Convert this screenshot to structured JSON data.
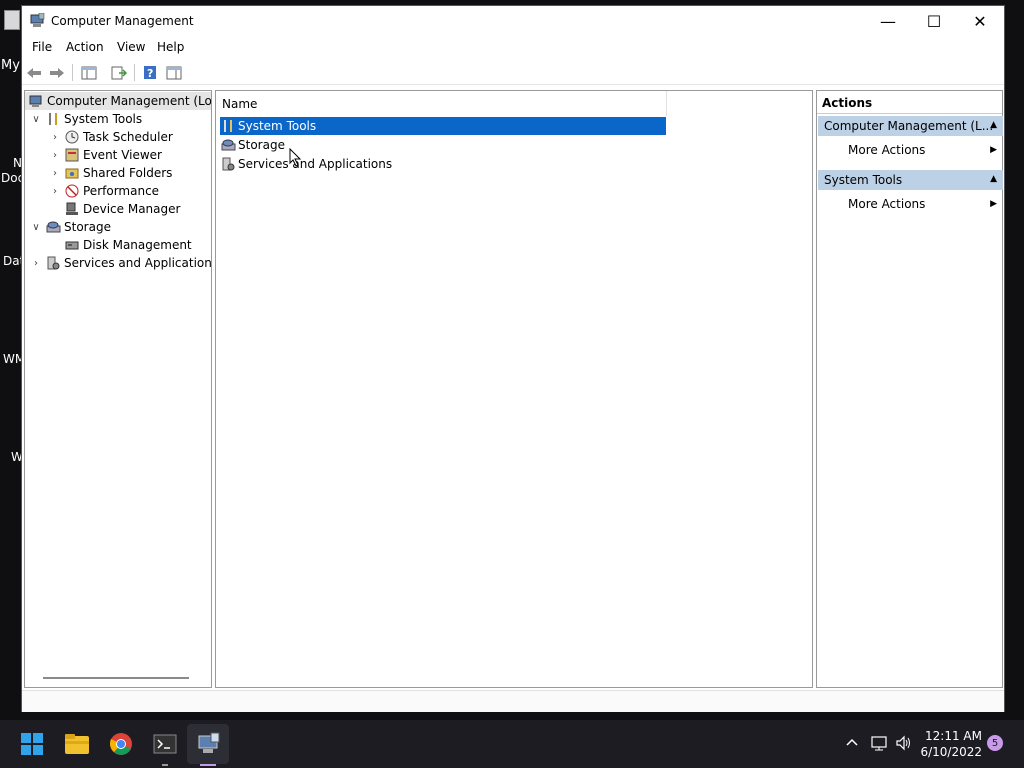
{
  "window": {
    "title": "Computer Management",
    "minimize_glyph": "—",
    "maximize_glyph": "☐",
    "close_glyph": "✕"
  },
  "desktop_icons": [
    "My",
    "N",
    "Doc",
    "Dat",
    "WM",
    "W"
  ],
  "menu": [
    "File",
    "Action",
    "View",
    "Help"
  ],
  "toolbar": {
    "back_icon": "back-arrow-icon",
    "forward_icon": "forward-arrow-icon",
    "show_hide_tree_icon": "console-tree-icon",
    "export_icon": "export-list-icon",
    "help_icon": "help-icon",
    "show_hide_action_icon": "action-pane-icon"
  },
  "tree": {
    "root": "Computer Management (Local",
    "items": [
      {
        "label": "System Tools",
        "icon": "tools-icon",
        "expanded": true
      },
      {
        "label": "Task Scheduler",
        "icon": "clock-icon"
      },
      {
        "label": "Event Viewer",
        "icon": "event-viewer-icon"
      },
      {
        "label": "Shared Folders",
        "icon": "shared-folder-icon"
      },
      {
        "label": "Performance",
        "icon": "performance-icon"
      },
      {
        "label": "Device Manager",
        "icon": "device-manager-icon"
      },
      {
        "label": "Storage",
        "icon": "storage-icon",
        "expanded": true
      },
      {
        "label": "Disk Management",
        "icon": "disk-icon"
      },
      {
        "label": "Services and Applications",
        "icon": "services-icon",
        "expanded": false
      }
    ]
  },
  "list": {
    "column_name": "Name",
    "rows": [
      {
        "label": "System Tools",
        "selected": true
      },
      {
        "label": "Storage"
      },
      {
        "label": "Services and Applications"
      }
    ]
  },
  "actions": {
    "header": "Actions",
    "sections": [
      {
        "title": "Computer Management (L...",
        "item": "More Actions"
      },
      {
        "title": "System Tools",
        "item": "More Actions"
      }
    ]
  },
  "taskbar": {
    "clock_time": "12:11 AM",
    "clock_date": "6/10/2022",
    "notification_count": "5",
    "apps": [
      "start-icon",
      "file-explorer-icon",
      "chrome-icon",
      "terminal-icon",
      "computer-management-icon"
    ]
  },
  "colors": {
    "selection": "#0a66c8",
    "action_section": "#bcd0e6",
    "taskbar": "#1c1c22"
  }
}
